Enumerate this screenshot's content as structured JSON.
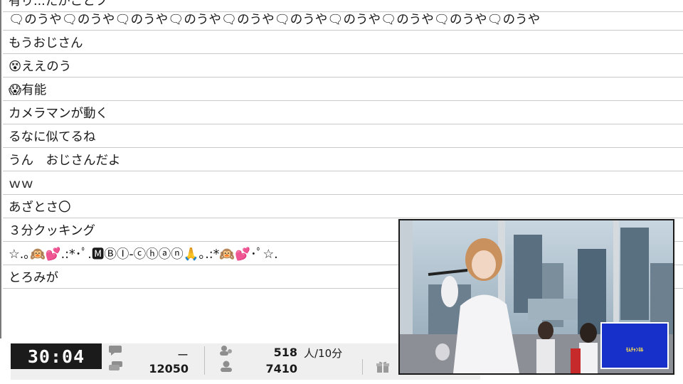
{
  "comments": [
    {
      "text": "有り...たがことフ",
      "partial": true
    },
    {
      "text": "🗨のうや🗨のうや🗨のうや🗨のうや🗨のうや🗨のうや🗨のうや🗨のうや🗨のうや🗨のうや"
    },
    {
      "text": "もうおじさん"
    },
    {
      "text": "😵ええのう"
    },
    {
      "text": "😱有能"
    },
    {
      "text": "カメラマンが動く"
    },
    {
      "text": "るなに似てるね"
    },
    {
      "text": "うん　おじさんだよ"
    },
    {
      "text": "ｗｗ"
    },
    {
      "text": "あざとさ〇"
    },
    {
      "text": "３分クッキング"
    },
    {
      "text": "☆.｡🙉💕.:*･ﾟ.🅼ⒷⒾ-ⓒⓗⓐⓝ🙏｡.:*🙉💕･ﾟ☆."
    },
    {
      "text": "とろみが"
    }
  ],
  "stats": {
    "elapsed_time": "30:04",
    "comments_per_interval": "ー",
    "total_comments": "12050",
    "viewers_rate": "518",
    "viewers_rate_unit": "人/10分",
    "total_viewers": "7410"
  },
  "video": {
    "logo_text": "ﾓﾑﾁｬﾝﾈﾙ"
  },
  "colors": {
    "timer_bg": "#1b1b1b",
    "row_border": "#c9c9c9",
    "logo_bg": "#1730c9"
  }
}
